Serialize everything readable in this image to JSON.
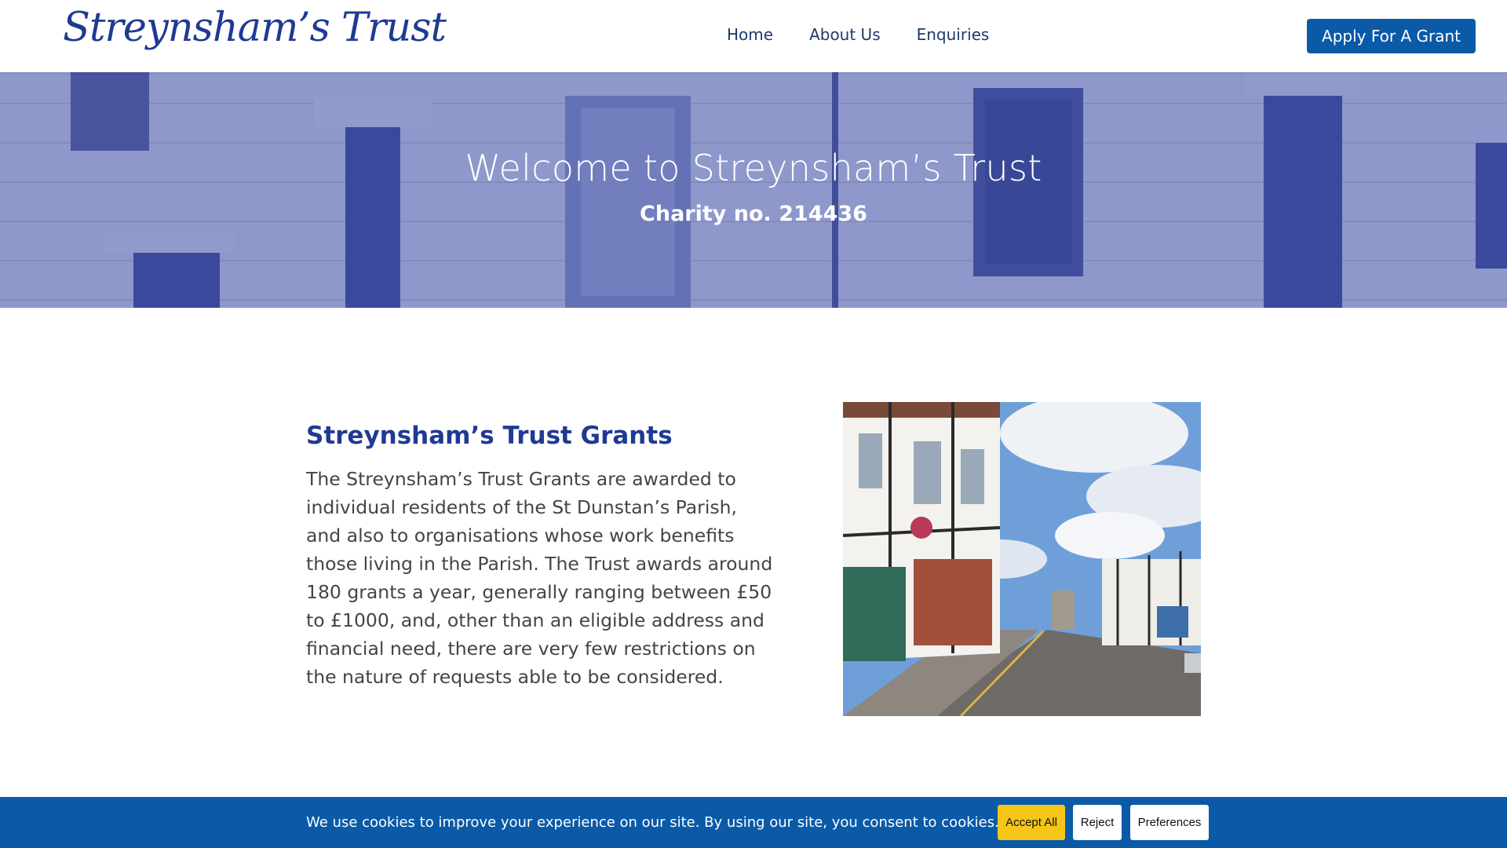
{
  "header": {
    "logo_text": "Streynsham’s Trust",
    "nav": [
      {
        "label": "Home"
      },
      {
        "label": "About Us"
      },
      {
        "label": "Enquiries"
      }
    ],
    "cta_label": "Apply For A Grant"
  },
  "hero": {
    "title": "Welcome to Streynsham’s Trust",
    "subtitle": "Charity no. 214436"
  },
  "main": {
    "heading": "Streynsham’s Trust Grants",
    "body": "The Streynsham’s Trust Grants are awarded to individual residents of the St Dunstan’s Parish, and also to organisations whose work benefits those living in the Parish. The Trust awards around 180 grants a year, generally ranging between £50 to £1000, and, other than an eligible address and financial need, there are very few restrictions on the nature of requests able to be considered."
  },
  "cookie": {
    "text": "We use cookies to improve your experience on our site. By using our site, you consent to cookies.",
    "accept_label": "Accept All",
    "reject_label": "Reject",
    "preferences_label": "Preferences"
  },
  "colors": {
    "brand_blue": "#1f3a93",
    "button_blue": "#0a5aa8",
    "accept_yellow": "#f5c518"
  }
}
